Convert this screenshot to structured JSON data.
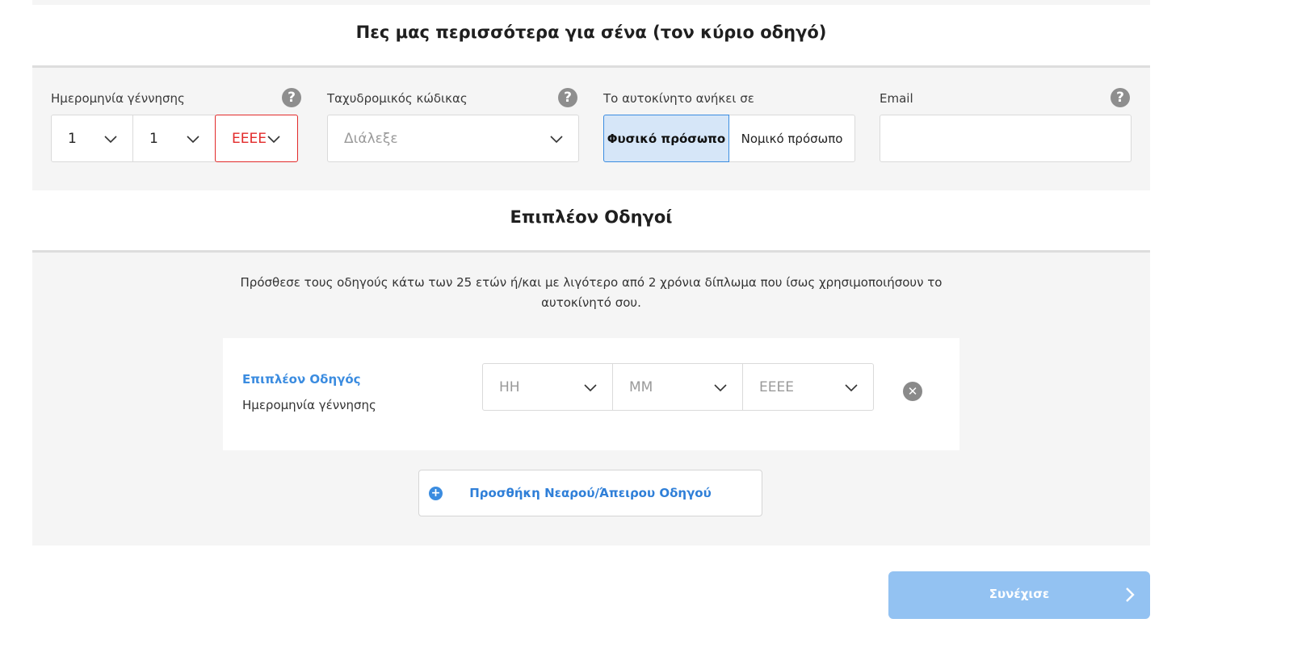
{
  "main_driver": {
    "title": "Πες μας περισσότερα για σένα (τον κύριο οδηγό)",
    "dob": {
      "label": "Ημερομηνία γέννησης",
      "day": "1",
      "month": "1",
      "year_placeholder": "ΕΕΕΕ",
      "help_icon": "question-icon"
    },
    "postal": {
      "label": "Ταχυδρομικός κώδικας",
      "placeholder": "Διάλεξε",
      "help_icon": "question-icon"
    },
    "owner": {
      "label": "Το αυτοκίνητο ανήκει σε",
      "options": [
        "Φυσικό πρόσωπο",
        "Νομικό πρόσωπο"
      ],
      "selected": "Φυσικό πρόσωπο"
    },
    "email": {
      "label": "Email",
      "value": "",
      "help_icon": "question-icon"
    }
  },
  "extra_drivers": {
    "title": "Επιπλέον Οδηγοί",
    "intro": "Πρόσθεσε τους οδηγούς κάτω των 25 ετών ή/και με λιγότερο από 2 χρόνια δίπλωμα που ίσως χρησιμοποιήσουν το αυτοκίνητό σου.",
    "driver": {
      "title": "Επιπλέον Οδηγός",
      "dob_label": "Ημερομηνία γέννησης",
      "day_placeholder": "ΗΗ",
      "month_placeholder": "ΜΜ",
      "year_placeholder": "ΕΕΕΕ",
      "remove_icon": "close-circle-icon"
    },
    "add_button": "Προσθήκη Νεαρού/Άπειρου Οδηγού"
  },
  "footer": {
    "continue_button": "Συνέχισε"
  },
  "colors": {
    "accent": "#3b8ce0",
    "error": "#e22a2a",
    "panel_bg": "#f5f5f5",
    "continue_disabled": "#93c2f2",
    "selected_toggle": "#d6e6f8"
  }
}
